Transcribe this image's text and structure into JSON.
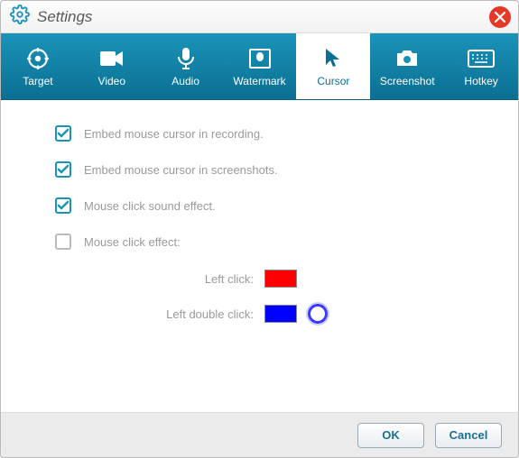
{
  "title": "Settings",
  "tabs": [
    {
      "id": "target",
      "label": "Target"
    },
    {
      "id": "video",
      "label": "Video"
    },
    {
      "id": "audio",
      "label": "Audio"
    },
    {
      "id": "watermark",
      "label": "Watermark"
    },
    {
      "id": "cursor",
      "label": "Cursor"
    },
    {
      "id": "screenshot",
      "label": "Screenshot"
    },
    {
      "id": "hotkey",
      "label": "Hotkey"
    }
  ],
  "active_tab": "cursor",
  "options": {
    "embed_recording": {
      "label": "Embed mouse cursor in recording.",
      "checked": true
    },
    "embed_screenshots": {
      "label": "Embed mouse cursor in screenshots.",
      "checked": true
    },
    "sound_effect": {
      "label": "Mouse click sound effect.",
      "checked": true
    },
    "click_effect": {
      "label": "Mouse click effect:",
      "checked": false
    }
  },
  "colors": {
    "left_click": {
      "label": "Left click:",
      "value": "#ff0000"
    },
    "left_double_click": {
      "label": "Left double click:",
      "value": "#0000ff"
    }
  },
  "buttons": {
    "ok": "OK",
    "cancel": "Cancel"
  }
}
